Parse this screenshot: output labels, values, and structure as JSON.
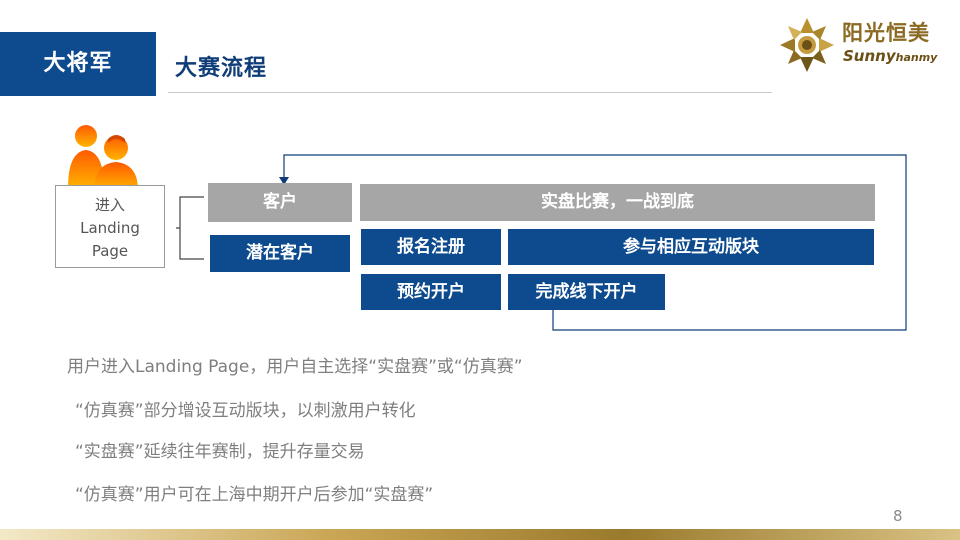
{
  "header": {
    "section_label": "大将军",
    "title": "大赛流程"
  },
  "logo": {
    "name_cn": "阳光恒美",
    "name_en_main": "Sunny",
    "name_en_sub": "hanmy"
  },
  "flow": {
    "entry": "进入\nLanding\nPage",
    "customer": "客户",
    "potential_customer": "潜在客户",
    "live_contest": "实盘比赛，一战到底",
    "register": "报名注册",
    "interact": "参与相应互动版块",
    "appointment": "预约开户",
    "offline_open": "完成线下开户"
  },
  "bullets": [
    "用户进入Landing Page，用户自主选择“实盘赛”或“仿真赛”",
    "“仿真赛”部分增设互动版块，以刺激用户转化",
    "“实盘赛”延续往年赛制，提升存量交易",
    "“仿真赛”用户可在上海中期开户后参加“实盘赛”"
  ],
  "slide_number": "8",
  "colors": {
    "primary_blue": "#0e4b8e",
    "box_gray": "#a6a6a6",
    "person_orange": "#ff6600",
    "logo_gold": "#8b6b23"
  }
}
